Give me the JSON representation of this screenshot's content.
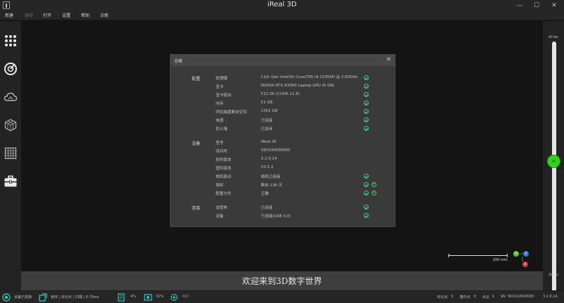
{
  "window": {
    "title": "iReal 3D",
    "minimize": "—",
    "maximize": "☐",
    "close": "✕"
  },
  "menu": [
    {
      "label": "新建",
      "enabled": true
    },
    {
      "label": "保存",
      "enabled": false
    },
    {
      "label": "打开",
      "enabled": true
    },
    {
      "label": "设置",
      "enabled": true
    },
    {
      "label": "帮助",
      "enabled": true
    },
    {
      "label": "诊断",
      "enabled": true
    }
  ],
  "left_toolbar": [
    "apps-grid-icon",
    "scan-target-icon",
    "cloud-icon",
    "cube-mesh-icon",
    "grid-table-icon",
    "toolbox-icon"
  ],
  "slider": {
    "top_label": "60 lbs",
    "bottom_label": "20 lbs",
    "knob_label": "40",
    "level_fraction": 0.52
  },
  "scale": {
    "label": "200 mm"
  },
  "axes": [
    {
      "label": "Y",
      "color": "#5cc92a"
    },
    {
      "label": "Z",
      "color": "#2f74d6"
    },
    {
      "label": "X",
      "color": "#d23a3a"
    }
  ],
  "welcome": "欢迎来到3D数字世界",
  "dialog": {
    "title": "诊断",
    "close": "✕",
    "sections": [
      {
        "heading": "配置",
        "rows": [
          {
            "label": "处理器",
            "value": "11th Gen Intel(R) Core(TM) i9-11950H @ 2.60GHz",
            "status": [
              "ok"
            ]
          },
          {
            "label": "显卡",
            "value": "NVIDIA RTX A3000 Laptop GPU (6 GB)",
            "status": [
              "ok"
            ]
          },
          {
            "label": "显卡驱动",
            "value": "512.36 (CUDA 11.6)",
            "status": [
              "ok"
            ]
          },
          {
            "label": "内存",
            "value": "51 GB",
            "status": [
              "ok"
            ]
          },
          {
            "label": "所在磁盘剩余空间",
            "value": "1261 GB",
            "status": [
              "ok"
            ]
          },
          {
            "label": "电源",
            "value": "已连接",
            "status": [
              "ok"
            ]
          },
          {
            "label": "防火墙",
            "value": "已关闭",
            "status": [
              "ok"
            ]
          }
        ]
      },
      {
        "heading": "设备",
        "rows": [
          {
            "label": "型号",
            "value": "iReal 2E",
            "status": []
          },
          {
            "label": "序列号",
            "value": "SK01IU0D0083",
            "status": []
          },
          {
            "label": "软件版本",
            "value": "3.2.0.14",
            "status": []
          },
          {
            "label": "固件版本",
            "value": "V3.5.2",
            "status": []
          },
          {
            "label": "相机驱动",
            "value": "相机已连接",
            "status": [
              "ok"
            ]
          },
          {
            "label": "授权",
            "value": "剩余 136 天",
            "status": [
              "ok",
              "plus"
            ]
          },
          {
            "label": "配置文件",
            "value": "正确",
            "status": [
              "ok",
              "plus"
            ]
          }
        ]
      },
      {
        "heading": "连接",
        "rows": [
          {
            "label": "加密狗",
            "value": "已连接",
            "status": [
              "ok"
            ]
          },
          {
            "label": "设备",
            "value": "已连接(USB 3.0)",
            "status": [
              "ok"
            ]
          }
        ]
      }
    ]
  },
  "status": {
    "connection": "设备已连接",
    "frame_info": "帧体 | 标记点 | 扫描 | 0.79ms",
    "mem": "4%",
    "gpu": "32%",
    "temp": "0.0",
    "right": [
      {
        "label": "标记点",
        "value": "0"
      },
      {
        "label": "描中点",
        "value": "0"
      },
      {
        "label": "点云",
        "value": "0"
      },
      {
        "label": "SN",
        "value": "SK01IU0D0083"
      },
      {
        "label": "",
        "value": "3.2.0.14"
      }
    ]
  }
}
